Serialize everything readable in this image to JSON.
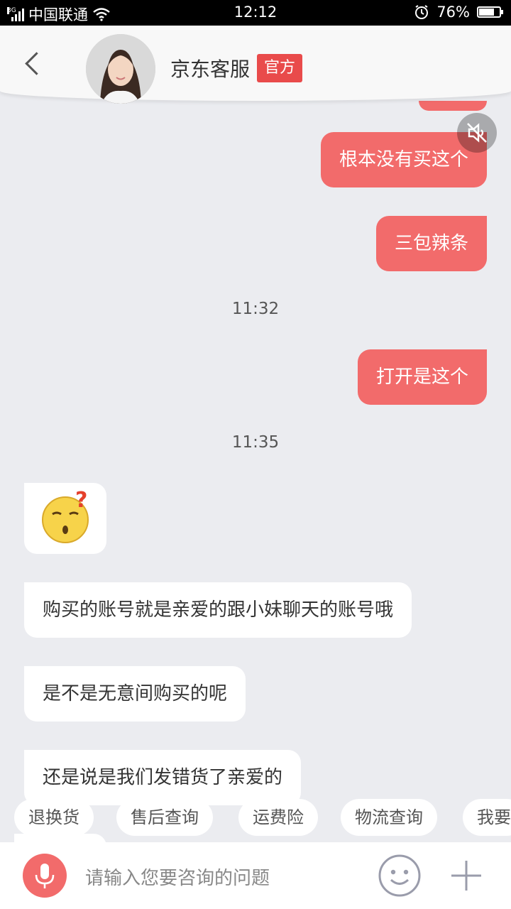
{
  "status_bar": {
    "network": "3G",
    "carrier": "中国联通",
    "time": "12:12",
    "battery": "76%",
    "battery_level": 0.76
  },
  "header": {
    "name": "京东客服",
    "tag": "官方"
  },
  "messages": [
    {
      "dir": "out",
      "text": "根本没有买这个"
    },
    {
      "dir": "out",
      "text": "三包辣条"
    },
    {
      "type": "time",
      "text": "11:32"
    },
    {
      "dir": "out",
      "text": "打开是这个"
    },
    {
      "type": "time",
      "text": "11:35"
    },
    {
      "dir": "in",
      "type": "emoji",
      "icon": "confused-face-icon"
    },
    {
      "dir": "in",
      "text": "购买的账号就是亲爱的跟小妹聊天的账号哦"
    },
    {
      "dir": "in",
      "text": "是不是无意间购买的呢"
    },
    {
      "dir": "in",
      "text": "还是说是我们发错货了亲爱的"
    }
  ],
  "quick_chips": [
    "退换货",
    "售后查询",
    "运费险",
    "物流查询",
    "我要"
  ],
  "input": {
    "placeholder": "请输入您要咨询的问题"
  },
  "colors": {
    "accent": "#f26b6b",
    "tag": "#e94b4b",
    "chat_background": "#ebecf0"
  }
}
